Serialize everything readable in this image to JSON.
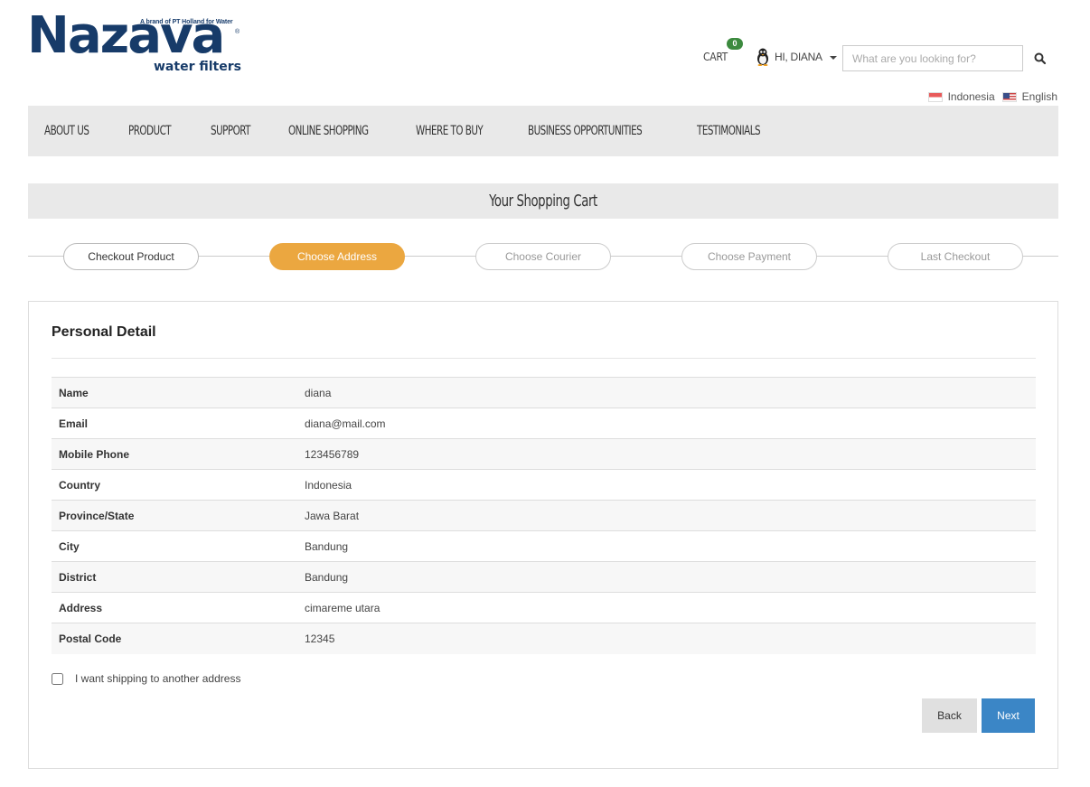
{
  "logo": {
    "tagline": "A brand of PT Holland for Water",
    "name": "Nazava",
    "reg": "®",
    "sub": "water filters"
  },
  "header": {
    "cart_label": "CART",
    "cart_count": "0",
    "user_label": "HI, DIANA",
    "search_placeholder": "What are you looking for?",
    "languages": [
      "Indonesia",
      "English"
    ]
  },
  "nav": [
    "ABOUT US",
    "PRODUCT",
    "SUPPORT",
    "ONLINE SHOPPING",
    "WHERE TO BUY",
    "BUSINESS OPPORTUNITIES",
    "TESTIMONIALS"
  ],
  "cart_title": "Your Shopping Cart",
  "steps": [
    "Checkout Product",
    "Choose Address",
    "Choose Courier",
    "Choose Payment",
    "Last Checkout"
  ],
  "panel": {
    "title": "Personal Detail",
    "rows": [
      {
        "label": "Name",
        "value": "diana"
      },
      {
        "label": "Email",
        "value": "diana@mail.com"
      },
      {
        "label": "Mobile Phone",
        "value": "123456789"
      },
      {
        "label": "Country",
        "value": "Indonesia"
      },
      {
        "label": "Province/State",
        "value": "Jawa Barat"
      },
      {
        "label": "City",
        "value": "Bandung"
      },
      {
        "label": "District",
        "value": "Bandung"
      },
      {
        "label": "Address",
        "value": "cimareme utara"
      },
      {
        "label": "Postal Code",
        "value": "12345"
      }
    ],
    "ship_label": "I want shipping to another address",
    "back_label": "Back",
    "next_label": "Next"
  }
}
